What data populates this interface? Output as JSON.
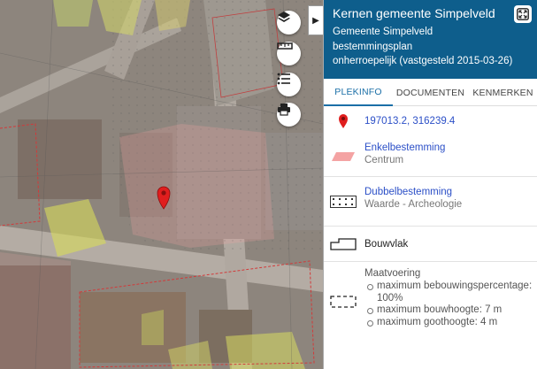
{
  "panel": {
    "title": "Kernen gemeente Simpelveld",
    "municipality": "Gemeente Simpelveld",
    "plan_type": "bestemmingsplan",
    "status": "onherroepelijk (vastgesteld 2015-03-26)"
  },
  "tabs": [
    {
      "label": "PLEKINFO",
      "active": true
    },
    {
      "label": "DOCUMENTEN",
      "active": false
    },
    {
      "label": "KENMERKEN",
      "active": false
    }
  ],
  "location": {
    "coordinates": "197013.2, 316239.4"
  },
  "enkelbestemming": {
    "title": "Enkelbestemming",
    "value": "Centrum",
    "swatch_color": "#f4a3a3"
  },
  "dubbelbestemming": {
    "title": "Dubbelbestemming",
    "value": "Waarde - Archeologie"
  },
  "bouwvlak": {
    "label": "Bouwvlak"
  },
  "maatvoering": {
    "title": "Maatvoering",
    "items": [
      "maximum bebouwingspercentage: 100%",
      "maximum bouwhoogte: 7 m",
      "maximum goothoogte: 4 m"
    ]
  },
  "map_tools": [
    "layers-icon",
    "ruler-icon",
    "legend-list-icon",
    "print-icon"
  ],
  "colors": {
    "header_bg": "#0e5e8c",
    "accent": "#1b6fa7",
    "link": "#2b4fc7",
    "marker": "#e01e1e"
  }
}
